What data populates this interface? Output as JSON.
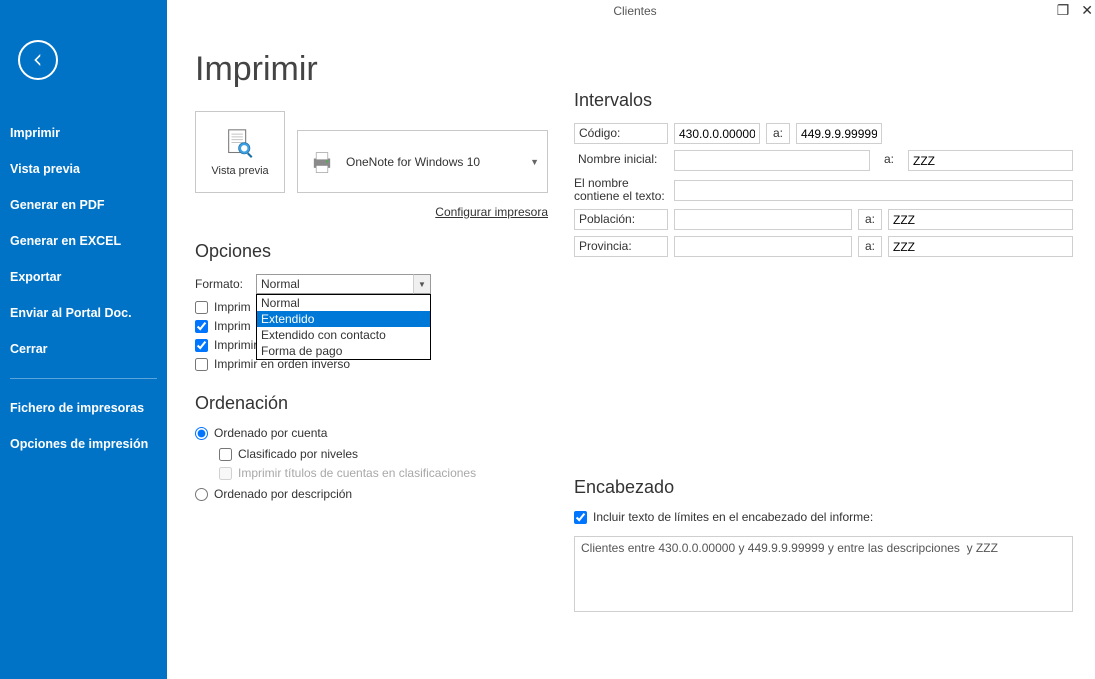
{
  "window_title": "Clientes",
  "sidebar": {
    "items": [
      "Imprimir",
      "Vista previa",
      "Generar en PDF",
      "Generar en EXCEL",
      "Exportar",
      "Enviar al Portal Doc.",
      "Cerrar"
    ],
    "items2": [
      "Fichero de impresoras",
      "Opciones de impresión"
    ]
  },
  "page_title": "Imprimir",
  "preview_label": "Vista previa",
  "printer_name": "OneNote for Windows 10",
  "config_link": "Configurar impresora",
  "opciones": {
    "title": "Opciones",
    "formato_label": "Formato:",
    "formato_selected": "Normal",
    "formato_options": [
      "Normal",
      "Extendido",
      "Extendido con contacto",
      "Forma de pago"
    ],
    "formato_highlight_index": 1,
    "chk_imprim": "Imprim",
    "chk_imprim2": "Imprim",
    "chk_sin_mov": "Imprimir cuentas sin movimientos",
    "chk_inverso": "Imprimir en orden inverso"
  },
  "ordenacion": {
    "title": "Ordenación",
    "rad_cuenta": "Ordenado por cuenta",
    "chk_clasificado": "Clasificado por niveles",
    "chk_titulos": "Imprimir títulos de cuentas en clasificaciones",
    "rad_desc": "Ordenado por descripción"
  },
  "intervalos": {
    "title": "Intervalos",
    "codigo_label": "Código:",
    "codigo_from": "430.0.0.00000",
    "codigo_to": "449.9.9.99999",
    "nombre_label": "Nombre inicial:",
    "nombre_from": "",
    "nombre_to": "ZZZ",
    "contiene_label1": "El nombre",
    "contiene_label2": "contiene el texto:",
    "contiene_val": "",
    "poblacion_label": "Población:",
    "poblacion_from": "",
    "poblacion_to": "ZZZ",
    "provincia_label": "Provincia:",
    "provincia_from": "",
    "provincia_to": "ZZZ",
    "a": "a:"
  },
  "encabezado": {
    "title": "Encabezado",
    "chk": "Incluir texto de límites en el encabezado del informe:",
    "text": "Clientes entre 430.0.0.00000 y 449.9.9.99999 y entre las descripciones  y ZZZ"
  }
}
